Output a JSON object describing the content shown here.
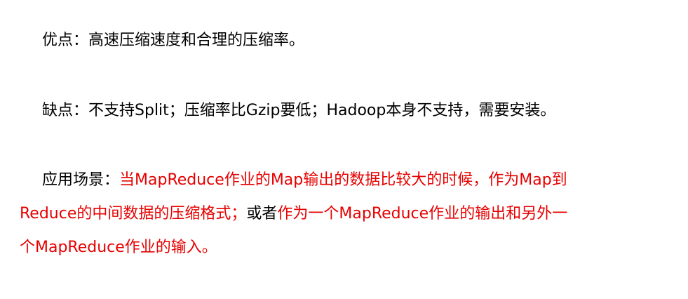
{
  "document": {
    "pros": {
      "label": "优点：",
      "text": "高速压缩速度和合理的压缩率。"
    },
    "cons": {
      "label": "缺点：",
      "text": "不支持Split；压缩率比Gzip要低；Hadoop本身不支持，需要安装。"
    },
    "usage": {
      "label": "应用场景：",
      "line1_red": "当MapReduce作业的Map输出的数据比较大的时候，作为Map到",
      "line2_red": "Reduce的中间数据的压缩格式；",
      "line2_black": "或者",
      "line2_red2": "作为一个MapReduce作业的输出和另外一",
      "line3_red": "个MapReduce作业的输入。"
    },
    "colors": {
      "text": "#000000",
      "highlight": "#e60000"
    }
  }
}
